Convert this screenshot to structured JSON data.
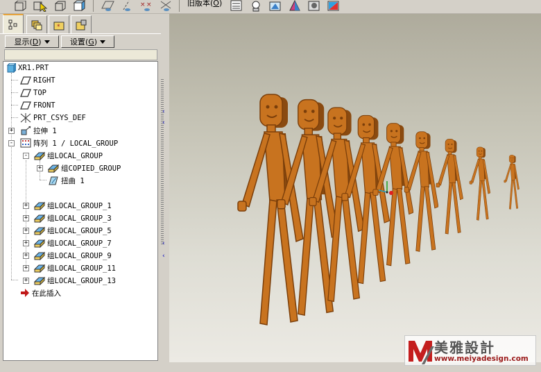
{
  "toolbar": {
    "version_label": "旧版本",
    "version_key": "O",
    "icons": [
      "view-box-icon",
      "select-cursor-icon",
      "cube-icon",
      "shaded-cube-icon",
      "datum-plane-icon",
      "datum-axis-icon",
      "datum-point-icon",
      "coordinate-system-icon",
      "model-tree-icon",
      "light-icon",
      "view-manager-icon",
      "appearance-icon",
      "render-icon",
      "color-palette-icon"
    ]
  },
  "tabs": [
    {
      "name": "model-tree",
      "icon": "tree-structure-icon",
      "active": true
    },
    {
      "name": "layers",
      "icon": "layers-icon",
      "active": false
    },
    {
      "name": "favorites",
      "icon": "star-folder-icon",
      "active": false
    },
    {
      "name": "settings",
      "icon": "settings-folder-icon",
      "active": false
    }
  ],
  "dropdowns": {
    "show": {
      "label": "显示",
      "key": "D"
    },
    "settings": {
      "label": "设置",
      "key": "G"
    }
  },
  "tree": [
    {
      "label": "XR1.PRT",
      "icon": "part-icon",
      "level": 0,
      "expander": ""
    },
    {
      "label": "RIGHT",
      "icon": "datum-plane-icon",
      "level": 1,
      "expander": ""
    },
    {
      "label": "TOP",
      "icon": "datum-plane-icon",
      "level": 1,
      "expander": ""
    },
    {
      "label": "FRONT",
      "icon": "datum-plane-icon",
      "level": 1,
      "expander": ""
    },
    {
      "label": "PRT_CSYS_DEF",
      "icon": "coordinate-system-icon",
      "level": 1,
      "expander": ""
    },
    {
      "label": "拉伸 1",
      "icon": "extrude-icon",
      "level": 1,
      "expander": "+"
    },
    {
      "label": "阵列 1 / LOCAL_GROUP",
      "icon": "pattern-icon",
      "level": 1,
      "expander": "-"
    },
    {
      "label": "组LOCAL_GROUP",
      "icon": "group-icon",
      "level": 2,
      "expander": "-"
    },
    {
      "label": "组COPIED_GROUP",
      "icon": "group-icon",
      "level": 3,
      "expander": "+"
    },
    {
      "label": "扭曲 1",
      "icon": "warp-icon",
      "level": 3,
      "expander": ""
    },
    {
      "label": "组LOCAL_GROUP_1",
      "icon": "group-icon",
      "level": 2,
      "expander": "+"
    },
    {
      "label": "组LOCAL_GROUP_3",
      "icon": "group-icon",
      "level": 2,
      "expander": "+"
    },
    {
      "label": "组LOCAL_GROUP_5",
      "icon": "group-icon",
      "level": 2,
      "expander": "+"
    },
    {
      "label": "组LOCAL_GROUP_7",
      "icon": "group-icon",
      "level": 2,
      "expander": "+"
    },
    {
      "label": "组LOCAL_GROUP_9",
      "icon": "group-icon",
      "level": 2,
      "expander": "+"
    },
    {
      "label": "组LOCAL_GROUP_11",
      "icon": "group-icon",
      "level": 2,
      "expander": "+"
    },
    {
      "label": "组LOCAL_GROUP_13",
      "icon": "group-icon",
      "level": 2,
      "expander": "+"
    },
    {
      "label": "在此插入",
      "icon": "insert-here-arrow-icon",
      "level": 1,
      "expander": ""
    }
  ],
  "viewport": {
    "model": "row-of-stick-figures",
    "figure_count": 9,
    "model_color": "#c8731f",
    "background": "gradient-gray"
  },
  "watermark": {
    "title": "美雅設計",
    "url": "www.meiyadesign.com",
    "logo": "my-logo-icon",
    "logo_colors": [
      "#c41e1e",
      "#6a6a6a"
    ]
  }
}
